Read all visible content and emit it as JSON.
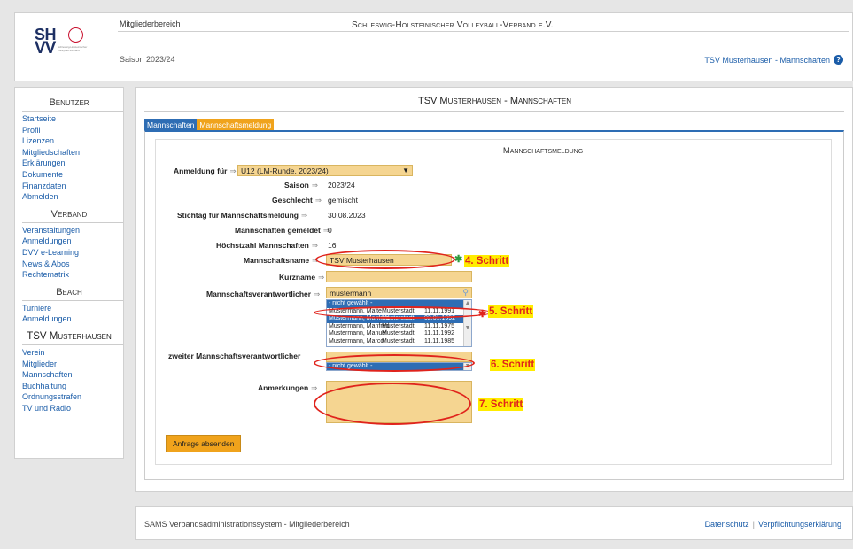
{
  "header": {
    "title": "Schleswig-Holsteinischer Volleyball-Verband e.V.",
    "area": "Mitgliederbereich",
    "season": "Saison 2023/24",
    "club_context": "TSV Musterhausen - Mannschaften",
    "logo_text_sh": "SH",
    "logo_text_vv": "VV",
    "logo_tagline": "Schleswig-Holsteinischer Volleyball-Verband"
  },
  "sidebar": {
    "sections": [
      {
        "title": "Benutzer",
        "items": [
          "Startseite",
          "Profil",
          "Lizenzen",
          "Mitgliedschaften",
          "Erklärungen",
          "Dokumente",
          "Finanzdaten",
          "Abmelden"
        ]
      },
      {
        "title": "Verband",
        "items": [
          "Veranstaltungen",
          "Anmeldungen",
          "DVV e-Learning",
          "News & Abos",
          "Rechtematrix"
        ]
      },
      {
        "title": "Beach",
        "items": [
          "Turniere",
          "Anmeldungen"
        ]
      },
      {
        "title": "TSV Musterhausen",
        "items": [
          "Verein",
          "Mitglieder",
          "Mannschaften",
          "Buchhaltung",
          "Ordnungsstrafen",
          "TV und Radio"
        ]
      }
    ]
  },
  "main": {
    "title": "TSV Musterhausen - Mannschaften",
    "tabs": [
      {
        "label": "Mannschaften"
      },
      {
        "label": "Mannschaftsmeldung"
      }
    ],
    "panel_title": "Mannschaftsmeldung"
  },
  "form": {
    "anmeldung_label": "Anmeldung für",
    "anmeldung_value": "U12 (LM-Runde, 2023/24)",
    "saison_label": "Saison",
    "saison_value": "2023/24",
    "geschlecht_label": "Geschlecht",
    "geschlecht_value": "gemischt",
    "stichtag_label": "Stichtag für Mannschaftsmeldung",
    "stichtag_value": "30.08.2023",
    "gemeldet_label": "Mannschaften gemeldet",
    "gemeldet_value": "0",
    "hoechstzahl_label": "Höchstzahl Mannschaften",
    "hoechstzahl_value": "16",
    "mannschaftsname_label": "Mannschaftsname",
    "mannschaftsname_value": "TSV Musterhausen",
    "kurzname_label": "Kurzname",
    "kurzname_value": "",
    "verantwortlicher_label": "Mannschaftsverantwortlicher",
    "verantwortlicher_search": "mustermann",
    "verantwortlicher_options": [
      {
        "name": "- nicht gewählt -",
        "city": "",
        "date": ""
      },
      {
        "name": "Mustermann, Malte",
        "city": "Musterstadt",
        "date": "11.11.1991"
      },
      {
        "name": "Mustermann, Manfred",
        "city": "Musterstadt",
        "date": "02.01.1992"
      },
      {
        "name": "Mustermann, Manfred",
        "city": "Musterstadt",
        "date": "11.11.1975"
      },
      {
        "name": "Mustermann, Manuel",
        "city": "Musterstadt",
        "date": "11.11.1992"
      },
      {
        "name": "Mustermann, Marco",
        "city": "Musterstadt",
        "date": "11.11.1985"
      }
    ],
    "zweiter_label": "zweiter Mannschaftsverantwortlicher",
    "zweiter_selected": "- nicht gewählt -",
    "anmerkungen_label": "Anmerkungen",
    "submit_label": "Anfrage absenden"
  },
  "annotations": {
    "step4": "4. Schritt",
    "step5": "5. Schritt",
    "step6": "6. Schritt",
    "step7": "7. Schritt"
  },
  "footer": {
    "text": "SAMS Verbandsadministrationssystem - Mitgliederbereich",
    "links": [
      "Datenschutz",
      "Verpflichtungserklärung"
    ]
  },
  "colors": {
    "link": "#1a5ca8",
    "tab_active": "#2e6db4",
    "tab_inactive": "#f0a31c",
    "field_bg": "#f5d591",
    "annotation_ring": "#e0231c",
    "annotation_bg": "#ffec00"
  }
}
